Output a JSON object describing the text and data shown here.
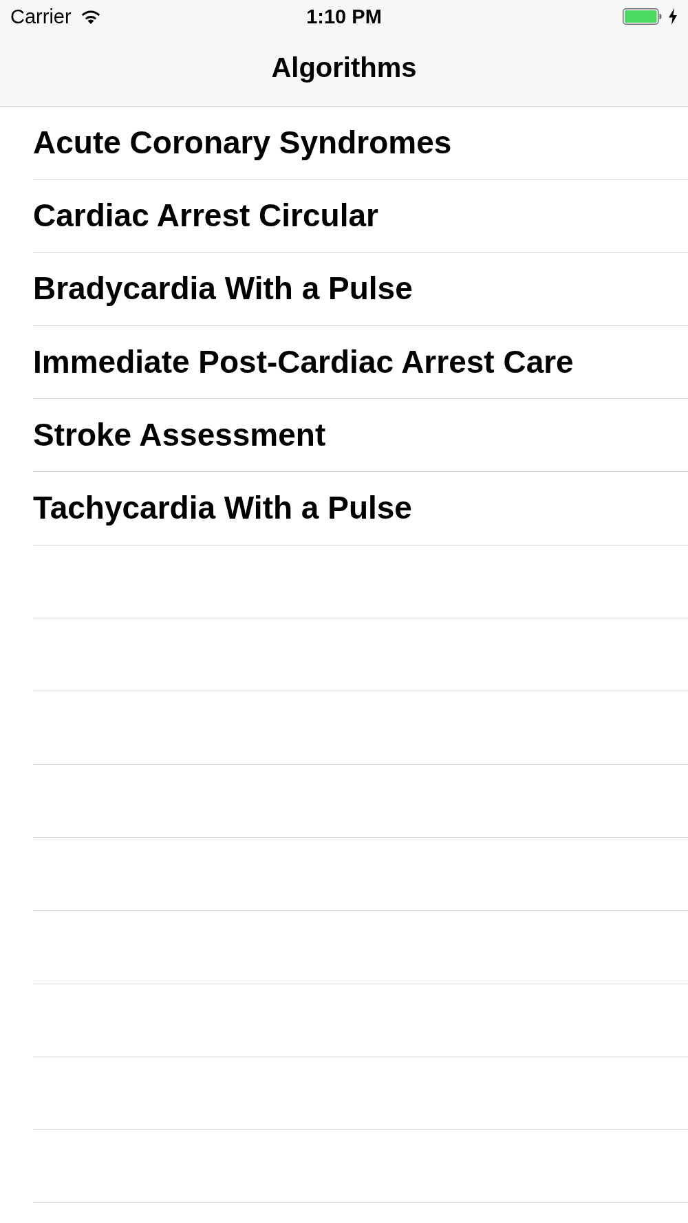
{
  "status_bar": {
    "carrier": "Carrier",
    "time": "1:10 PM",
    "charging": true
  },
  "nav_bar": {
    "title": "Algorithms"
  },
  "list": {
    "items": [
      {
        "label": "Acute Coronary Syndromes"
      },
      {
        "label": "Cardiac Arrest Circular"
      },
      {
        "label": "Bradycardia With a Pulse"
      },
      {
        "label": "Immediate Post-Cardiac Arrest Care"
      },
      {
        "label": "Stroke Assessment"
      },
      {
        "label": "Tachycardia With a Pulse"
      }
    ]
  }
}
